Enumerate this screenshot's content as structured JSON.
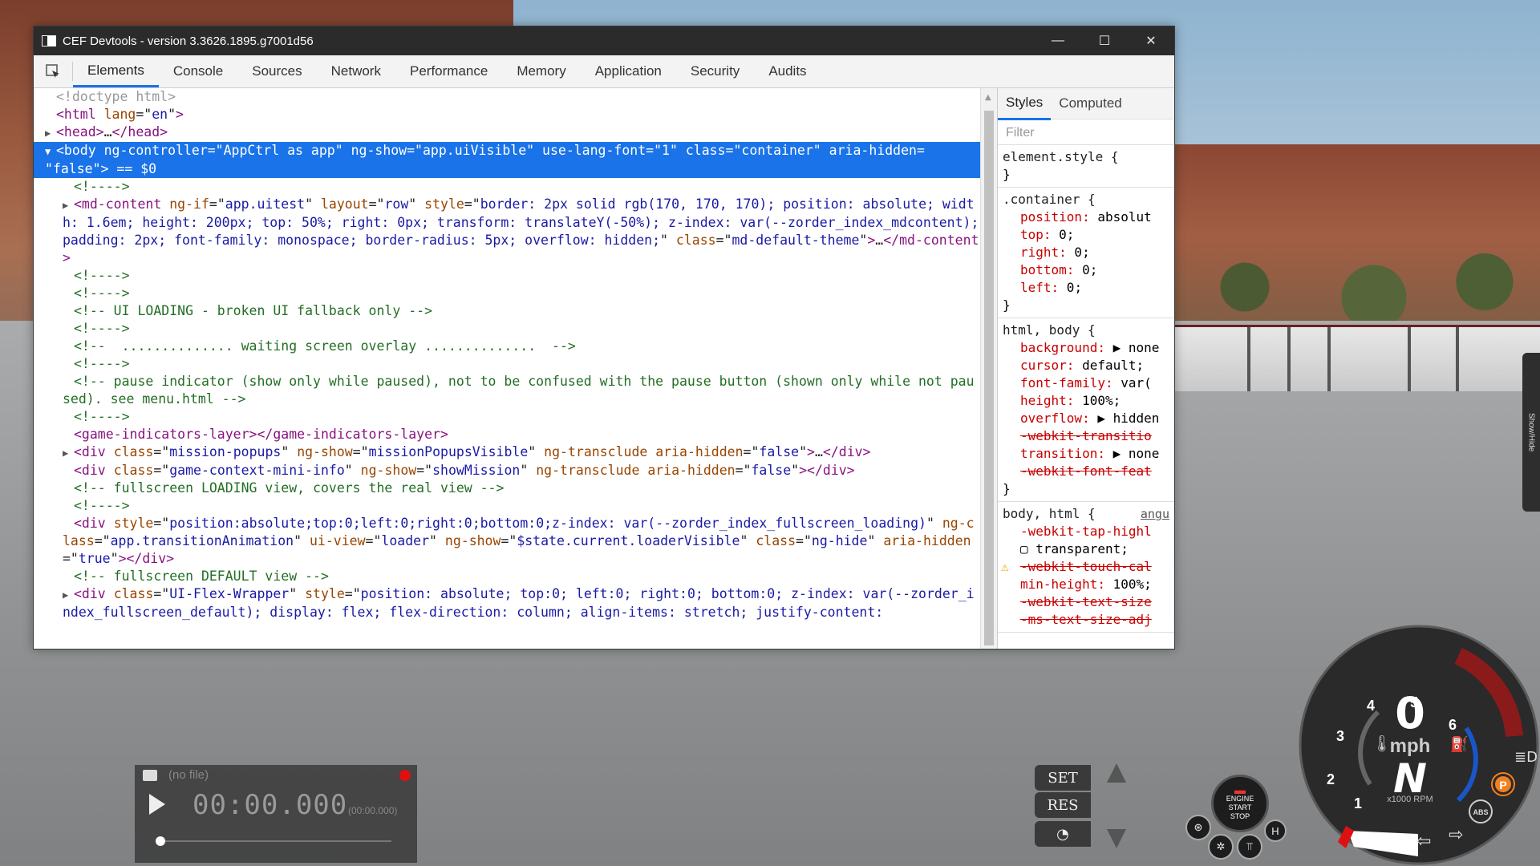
{
  "window": {
    "title": "CEF Devtools - version 3.3626.1895.g7001d56",
    "minimize": "—",
    "maximize": "☐",
    "close": "✕"
  },
  "tabs": [
    "Elements",
    "Console",
    "Sources",
    "Network",
    "Performance",
    "Memory",
    "Application",
    "Security",
    "Audits"
  ],
  "active_tab": "Elements",
  "elements": {
    "lines": [
      {
        "indent": 0,
        "tri": "",
        "html": "<span class='gray'>&lt;!doctype html&gt;</span>"
      },
      {
        "indent": 0,
        "tri": "",
        "html": "<span class='tag'>&lt;html</span> <span class='an'>lang</span>=\"<span class='av'>en</span>\"<span class='tag'>&gt;</span>"
      },
      {
        "indent": 0,
        "tri": "▶",
        "html": "<span class='tag'>&lt;head&gt;</span>…<span class='tag'>&lt;/head&gt;</span>"
      },
      {
        "indent": 0,
        "tri": "▼",
        "sel": true,
        "html": "<span class='tag'>&lt;body</span> <span class='an'>ng-controller</span>=\"<span class='av'>AppCtrl as app</span>\" <span class='an'>ng-show</span>=\"<span class='av'>app.uiVisible</span>\" <span class='an'>use-lang-font</span>=\"<span class='av'>1</span>\" <span class='an'>class</span>=\"<span class='av'>container</span>\" <span class='an'>aria-hidden</span>=\n\"<span class='av'>false</span>\"<span class='tag'>&gt;</span> == $0"
      },
      {
        "indent": 1,
        "tri": "",
        "html": "<span class='cm'>&lt;!----&gt;</span>"
      },
      {
        "indent": 1,
        "tri": "▶",
        "html": "<span class='tag'>&lt;md-content</span> <span class='an'>ng-if</span>=\"<span class='av'>app.uitest</span>\" <span class='an'>layout</span>=\"<span class='av'>row</span>\" <span class='an'>style</span>=\"<span class='av'>border: 2px solid rgb(170, 170, 170); position: absolute; width: 1.6em; height: 200px; top: 50%; right: 0px; transform: translateY(-50%); z-index: var(--zorder_index_mdcontent); padding: 2px; font-family: monospace; border-radius: 5px; overflow: hidden;</span>\" <span class='an'>class</span>=\"<span class='av'>md-default-theme</span>\"<span class='tag'>&gt;</span>…<span class='tag'>&lt;/md-content&gt;</span>"
      },
      {
        "indent": 1,
        "tri": "",
        "html": "<span class='cm'>&lt;!----&gt;</span>"
      },
      {
        "indent": 1,
        "tri": "",
        "html": "<span class='cm'>&lt;!----&gt;</span>"
      },
      {
        "indent": 1,
        "tri": "",
        "html": "<span class='cm'>&lt;!-- UI LOADING - broken UI fallback only --&gt;</span>"
      },
      {
        "indent": 1,
        "tri": "",
        "html": "<span class='cm'>&lt;!----&gt;</span>"
      },
      {
        "indent": 1,
        "tri": "",
        "html": "<span class='cm'>&lt;!--  .............. waiting screen overlay ..............  --&gt;</span>"
      },
      {
        "indent": 1,
        "tri": "",
        "html": "<span class='cm'>&lt;!----&gt;</span>"
      },
      {
        "indent": 1,
        "tri": "",
        "html": "<span class='cm'>&lt;!-- pause indicator (show only while paused), not to be confused with the pause button (shown only while not paused). see menu.html --&gt;</span>"
      },
      {
        "indent": 1,
        "tri": "",
        "html": "<span class='cm'>&lt;!----&gt;</span>"
      },
      {
        "indent": 1,
        "tri": "",
        "html": "<span class='tag'>&lt;game-indicators-layer&gt;&lt;/game-indicators-layer&gt;</span>"
      },
      {
        "indent": 1,
        "tri": "▶",
        "html": "<span class='tag'>&lt;div</span> <span class='an'>class</span>=\"<span class='av'>mission-popups</span>\" <span class='an'>ng-show</span>=\"<span class='av'>missionPopupsVisible</span>\" <span class='an'>ng-transclude</span> <span class='an'>aria-hidden</span>=\"<span class='av'>false</span>\"<span class='tag'>&gt;</span>…<span class='tag'>&lt;/div&gt;</span>"
      },
      {
        "indent": 1,
        "tri": "",
        "html": "<span class='tag'>&lt;div</span> <span class='an'>class</span>=\"<span class='av'>game-context-mini-info</span>\" <span class='an'>ng-show</span>=\"<span class='av'>showMission</span>\" <span class='an'>ng-transclude</span> <span class='an'>aria-hidden</span>=\"<span class='av'>false</span>\"<span class='tag'>&gt;&lt;/div&gt;</span>"
      },
      {
        "indent": 1,
        "tri": "",
        "html": "<span class='cm'>&lt;!-- fullscreen LOADING view, covers the real view --&gt;</span>"
      },
      {
        "indent": 1,
        "tri": "",
        "html": "<span class='cm'>&lt;!----&gt;</span>"
      },
      {
        "indent": 1,
        "tri": "",
        "html": "<span class='tag'>&lt;div</span> <span class='an'>style</span>=\"<span class='av'>position:absolute;top:0;left:0;right:0;bottom:0;z-index: var(--zorder_index_fullscreen_loading)</span>\" <span class='an'>ng-class</span>=\"<span class='av'>app.transitionAnimation</span>\" <span class='an'>ui-view</span>=\"<span class='av'>loader</span>\" <span class='an'>ng-show</span>=\"<span class='av'>$state.current.loaderVisible</span>\" <span class='an'>class</span>=\"<span class='av'>ng-hide</span>\" <span class='an'>aria-hidden</span>=\"<span class='av'>true</span>\"<span class='tag'>&gt;&lt;/div&gt;</span>"
      },
      {
        "indent": 1,
        "tri": "",
        "html": "<span class='cm'>&lt;!-- fullscreen DEFAULT view --&gt;</span>"
      },
      {
        "indent": 1,
        "tri": "▶",
        "html": "<span class='tag'>&lt;div</span> <span class='an'>class</span>=\"<span class='av'>UI-Flex-Wrapper</span>\" <span class='an'>style</span>=\"<span class='av'>position: absolute; top:0; left:0; right:0; bottom:0; z-index: var(--zorder_index_fullscreen_default); display: flex; flex-direction: column; align-items: stretch; justify-content:</span>"
      }
    ]
  },
  "styles_panel": {
    "tabs": [
      "Styles",
      "Computed"
    ],
    "filter_placeholder": "Filter",
    "rules": [
      {
        "selector": "element.style {",
        "props": [],
        "close": "}"
      },
      {
        "selector": ".container {",
        "props": [
          {
            "name": "position",
            "value": "absolut"
          },
          {
            "name": "top",
            "value": "0;"
          },
          {
            "name": "right",
            "value": "0;"
          },
          {
            "name": "bottom",
            "value": "0;"
          },
          {
            "name": "left",
            "value": "0;"
          }
        ],
        "close": "}"
      },
      {
        "selector": "html, body {",
        "props": [
          {
            "name": "background",
            "value": "▶ none"
          },
          {
            "name": "cursor",
            "value": "default;"
          },
          {
            "name": "font-family",
            "value": "var("
          },
          {
            "name": "height",
            "value": "100%;"
          },
          {
            "name": "overflow",
            "value": "▶ hidden"
          },
          {
            "name": "-webkit-transitio",
            "value": "",
            "strike": true
          },
          {
            "name": "transition",
            "value": "▶ none"
          },
          {
            "name": "-webkit-font-feat",
            "value": "",
            "strike": true
          }
        ],
        "close": "}"
      },
      {
        "selector": "body, html {",
        "source": "angu",
        "props": [
          {
            "name": "-webkit-tap-highl",
            "value": ""
          },
          {
            "name": "",
            "value": "▢ transparent;"
          },
          {
            "name": "-webkit-touch-cal",
            "value": "",
            "strike": true,
            "warn": true
          },
          {
            "name": "min-height",
            "value": "100%;"
          },
          {
            "name": "-webkit-text-size",
            "value": "",
            "strike": true
          },
          {
            "name": "-ms-text-size-adj",
            "value": "",
            "strike": true
          }
        ],
        "close": ""
      }
    ]
  },
  "player": {
    "file": "(no file)",
    "time": "00:00.000",
    "time_small": "(00:00.000)"
  },
  "cruise": {
    "set": "SET",
    "res": "RES"
  },
  "gauge": {
    "speed": "0",
    "unit": "mph",
    "gear": "N",
    "rpm_label": "x1000 RPM",
    "ticks": [
      "1",
      "2",
      "3",
      "4",
      "5",
      "6"
    ],
    "abs": "ABS",
    "parking": "P"
  },
  "start_button": {
    "line1": "ENGINE",
    "line2": "START",
    "line3": "STOP"
  },
  "side_tab": "Show/Hide",
  "colors": {
    "accent": "#1a73e8",
    "redline": "#8b1a1a",
    "gauge_bg": "#2a2a2a"
  }
}
